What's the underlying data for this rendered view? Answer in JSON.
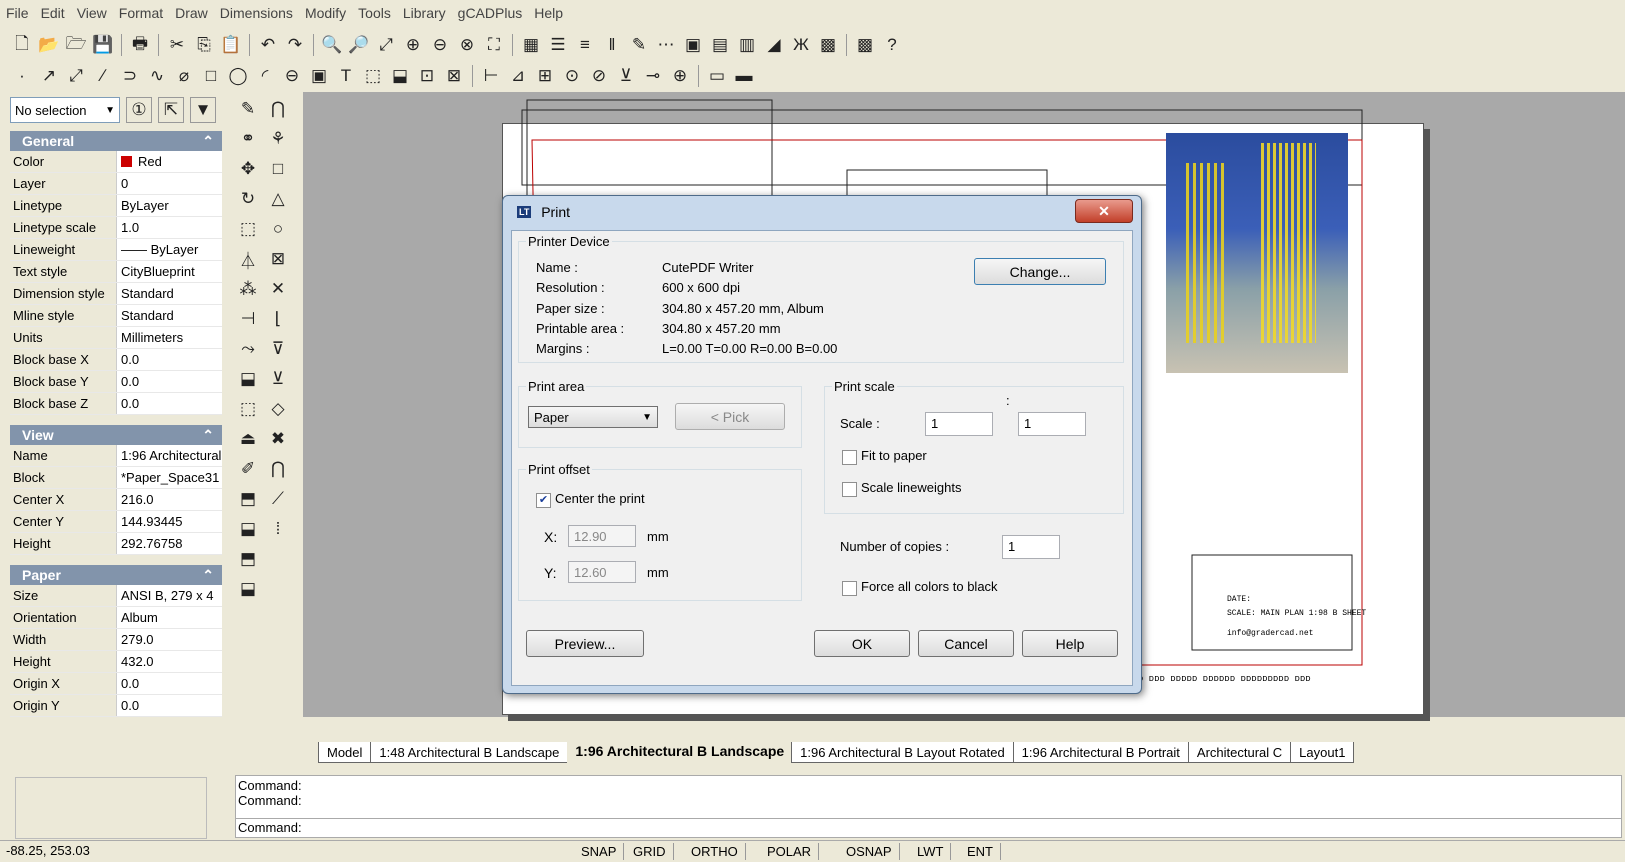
{
  "menu": [
    "File",
    "Edit",
    "View",
    "Format",
    "Draw",
    "Dimensions",
    "Modify",
    "Tools",
    "Library",
    "gCADPlus",
    "Help"
  ],
  "toolbar1": [
    "🗋",
    "📂",
    "🗁",
    "💾",
    "🖶",
    "✂",
    "⎘",
    "📋",
    "↶",
    "↷",
    "🔍",
    "🔎",
    "⤢",
    "⊕",
    "⊖",
    "⊗",
    "⛶",
    "▦",
    "☰",
    "≡",
    "‖",
    "✎",
    "⋯",
    "▣",
    "▤",
    "▥",
    "◢",
    "Ж",
    "▩",
    "▩",
    "?"
  ],
  "toolbar2": [
    "·",
    "↗",
    "⤢",
    "∕",
    "⊃",
    "∿",
    "⌀",
    "□",
    "◯",
    "◜",
    "⊖",
    "▣",
    "T",
    "⬚",
    "⬓",
    "⊡",
    "⊠",
    "⊢",
    "⊿",
    "⊞",
    "⊙",
    "⊘",
    "⊻",
    "⊸",
    "⊕",
    "▭",
    "▬"
  ],
  "leftpanel": {
    "selection": "No selection",
    "sections": [
      {
        "title": "General",
        "rows": [
          {
            "k": "Color",
            "v": "Red",
            "swatch": true
          },
          {
            "k": "Layer",
            "v": "0"
          },
          {
            "k": "Linetype",
            "v": "ByLayer"
          },
          {
            "k": "Linetype scale",
            "v": "1.0"
          },
          {
            "k": "Lineweight",
            "v": "—— ByLayer"
          },
          {
            "k": "Text style",
            "v": "CityBlueprint"
          },
          {
            "k": "Dimension style",
            "v": "Standard"
          },
          {
            "k": "Mline style",
            "v": "Standard"
          },
          {
            "k": "Units",
            "v": "Millimeters"
          },
          {
            "k": "Block base X",
            "v": "0.0"
          },
          {
            "k": "Block base Y",
            "v": "0.0"
          },
          {
            "k": "Block base Z",
            "v": "0.0"
          }
        ]
      },
      {
        "title": "View",
        "rows": [
          {
            "k": "Name",
            "v": "1:96 Architectural"
          },
          {
            "k": "Block",
            "v": "*Paper_Space31"
          },
          {
            "k": "Center X",
            "v": "216.0"
          },
          {
            "k": "Center Y",
            "v": "144.93445"
          },
          {
            "k": "Height",
            "v": "292.76758"
          }
        ]
      },
      {
        "title": "Paper",
        "rows": [
          {
            "k": "Size",
            "v": "ANSI B,  279 x 4"
          },
          {
            "k": "Orientation",
            "v": "Album"
          },
          {
            "k": "Width",
            "v": "279.0"
          },
          {
            "k": "Height",
            "v": "432.0"
          },
          {
            "k": "Origin X",
            "v": "0.0"
          },
          {
            "k": "Origin Y",
            "v": "0.0"
          }
        ]
      }
    ]
  },
  "tabs": [
    {
      "label": "Model",
      "active": false
    },
    {
      "label": "1:48 Architectural B Landscape",
      "active": false
    },
    {
      "label": "1:96 Architectural B Landscape",
      "active": true
    },
    {
      "label": "1:96 Architectural B Layout Rotated",
      "active": false
    },
    {
      "label": "1:96 Architectural B Portrait",
      "active": false
    },
    {
      "label": "Architectural C",
      "active": false
    },
    {
      "label": "Layout1",
      "active": false
    }
  ],
  "command": {
    "line1": "Command:",
    "line2": "Command:",
    "prompt": "Command:"
  },
  "status": {
    "coords": "-88.25,  253.03",
    "buttons": [
      "SNAP",
      "GRID",
      "ORTHO",
      "POLAR",
      "OSNAP",
      "LWT",
      "ENT"
    ]
  },
  "titleblock": {
    "line1": "DATE:",
    "line2": "SCALE:  MAIN PLAN 1:98 B SHEET",
    "line3": "info@gradercad.net",
    "footer": "ᴅ ᴅᴅᴅ ᴅᴅᴅᴅᴅ ᴅᴅᴅᴅᴅᴅ ᴅᴅᴅᴅᴅᴅᴅᴅᴅ ᴅᴅᴅ"
  },
  "dialog": {
    "title": "Print",
    "printer": {
      "group": "Printer Device",
      "name_k": "Name :",
      "name_v": "CutePDF Writer",
      "res_k": "Resolution :",
      "res_v": "600 x 600 dpi",
      "paper_k": "Paper size :",
      "paper_v": "304.80 x 457.20 mm,  Album",
      "printable_k": "Printable area :",
      "printable_v": "304.80 x 457.20 mm",
      "margins_k": "Margins :",
      "margins_v": "L=0.00  T=0.00  R=0.00  B=0.00",
      "change": "Change..."
    },
    "area": {
      "group": "Print area",
      "value": "Paper",
      "pick": "< Pick"
    },
    "offset": {
      "group": "Print offset",
      "center": "Center the print",
      "x_label": "X:",
      "x_value": "12.90",
      "y_label": "Y:",
      "y_value": "12.60",
      "unit": "mm"
    },
    "scale": {
      "group": "Print scale",
      "label": "Scale :",
      "colon": ":",
      "a": "1",
      "b": "1",
      "fit": "Fit to paper",
      "lineweights": "Scale lineweights"
    },
    "copies": {
      "label": "Number of copies :",
      "value": "1"
    },
    "black": "Force all colors to black",
    "buttons": {
      "preview": "Preview...",
      "ok": "OK",
      "cancel": "Cancel",
      "help": "Help"
    }
  }
}
